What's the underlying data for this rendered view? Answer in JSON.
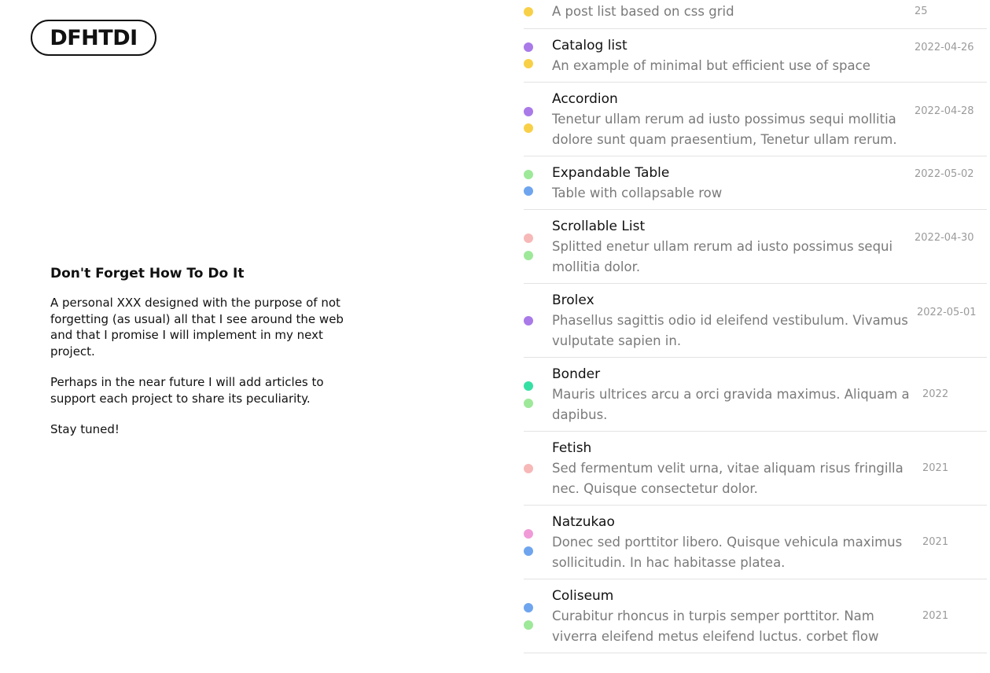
{
  "header": {
    "logo_text": "DFHTDI"
  },
  "intro": {
    "title": "Don't Forget How To Do It",
    "paragraph1": "A personal XXX designed with the purpose of not forgetting (as usual) all that I see around the web and that I promise I will implement in my next project.",
    "paragraph2": "Perhaps in the near future I will add articles to support each project to share its peculiarity.",
    "paragraph3": "Stay tuned!"
  },
  "colors": {
    "yellow": "#f8d048",
    "purple": "#a97ae8",
    "green": "#9ee89a",
    "blue": "#6fa5ee",
    "pink": "#f7b8b8",
    "teal": "#36e0a4",
    "magenta": "#f09bd8"
  },
  "list": {
    "items": [
      {
        "title": "",
        "description": "A post list based on css grid",
        "date": "25",
        "dots": [
          "yellow"
        ]
      },
      {
        "title": "Catalog list",
        "description": "An example of minimal but efficient use of space",
        "date": "2022-04-26",
        "dots": [
          "purple",
          "yellow"
        ]
      },
      {
        "title": "Accordion",
        "description": "Tenetur ullam rerum ad iusto possimus sequi mollitia dolore sunt quam praesentium, Tenetur ullam rerum.",
        "date": "2022-04-28",
        "dots": [
          "purple",
          "yellow"
        ]
      },
      {
        "title": "Expandable Table",
        "description": "Table with collapsable row",
        "date": "2022-05-02",
        "dots": [
          "green",
          "blue"
        ]
      },
      {
        "title": "Scrollable List",
        "description": "Splitted enetur ullam rerum ad iusto possimus sequi mollitia dolor.",
        "date": "2022-04-30",
        "dots": [
          "pink",
          "green"
        ]
      },
      {
        "title": "Brolex",
        "description": "Phasellus sagittis odio id eleifend vestibulum. Vivamus vulputate sapien in.",
        "date": "2022-05-01",
        "dots": [
          "purple"
        ]
      },
      {
        "title": "Bonder",
        "description": "Mauris ultrices arcu a orci gravida maximus. Aliquam a dapibus.",
        "date": "2022",
        "dots": [
          "teal",
          "green"
        ]
      },
      {
        "title": "Fetish",
        "description": "Sed fermentum velit urna, vitae aliquam risus fringilla nec. Quisque consectetur dolor.",
        "date": "2021",
        "dots": [
          "pink"
        ]
      },
      {
        "title": "Natzukao",
        "description": "Donec sed porttitor libero. Quisque vehicula maximus sollicitudin. In hac habitasse platea.",
        "date": "2021",
        "dots": [
          "magenta",
          "blue"
        ]
      },
      {
        "title": "Coliseum",
        "description": "Curabitur rhoncus in turpis semper porttitor. Nam viverra eleifend metus eleifend luctus. corbet flow",
        "date": "2021",
        "dots": [
          "blue",
          "green"
        ]
      }
    ]
  }
}
